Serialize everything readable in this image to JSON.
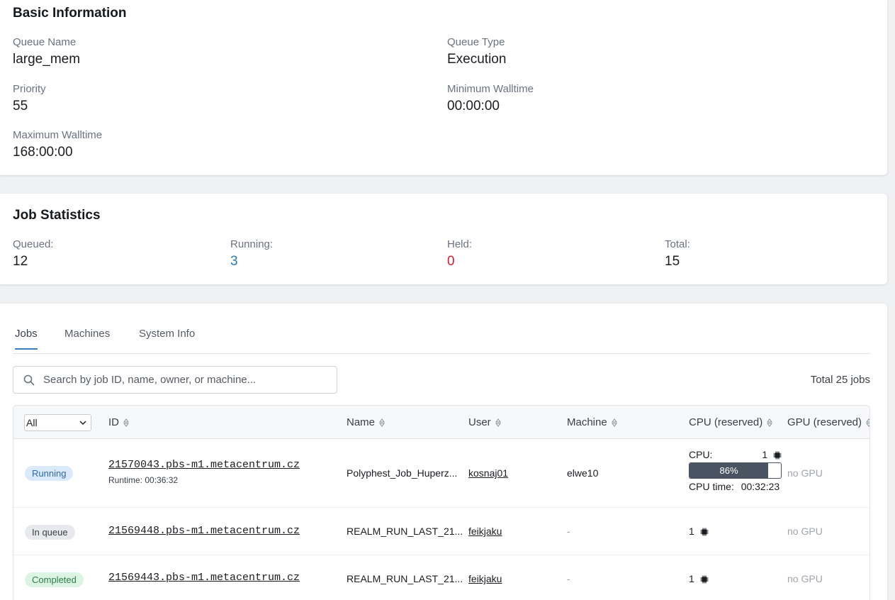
{
  "basic_info": {
    "title": "Basic Information",
    "fields": {
      "queue_name": {
        "label": "Queue Name",
        "value": "large_mem"
      },
      "queue_type": {
        "label": "Queue Type",
        "value": "Execution"
      },
      "priority": {
        "label": "Priority",
        "value": "55"
      },
      "min_walltime": {
        "label": "Minimum Walltime",
        "value": "00:00:00"
      },
      "max_walltime": {
        "label": "Maximum Walltime",
        "value": "168:00:00"
      }
    }
  },
  "job_stats": {
    "title": "Job Statistics",
    "queued": {
      "label": "Queued:",
      "value": "12"
    },
    "running": {
      "label": "Running:",
      "value": "3"
    },
    "held": {
      "label": "Held:",
      "value": "0"
    },
    "total": {
      "label": "Total:",
      "value": "15"
    },
    "colors": {
      "running": "#2a7ab8",
      "held": "#d3212d"
    }
  },
  "tabs": [
    {
      "label": "Jobs",
      "active": true
    },
    {
      "label": "Machines",
      "active": false
    },
    {
      "label": "System Info",
      "active": false
    }
  ],
  "search": {
    "placeholder": "Search by job ID, name, owner, or machine...",
    "value": ""
  },
  "total_jobs": "Total 25 jobs",
  "table": {
    "filter": {
      "selected": "All"
    },
    "headers": {
      "id": "ID",
      "name": "Name",
      "user": "User",
      "machine": "Machine",
      "cpu": "CPU (reserved)",
      "gpu": "GPU (reserved)"
    },
    "rows": [
      {
        "status": "Running",
        "id": "21570043.pbs-m1.metacentrum.cz",
        "runtime": "Runtime: 00:36:32",
        "name": "Polyphest_Job_Huperz...",
        "user": "kosnaj01",
        "machine": "elwe10",
        "cpu_label": "CPU:",
        "cpu_count": "1",
        "cpu_usage": "86%",
        "cpu_usage_fraction": 0.86,
        "cpu_time_label": "CPU time:",
        "cpu_time": "00:32:23",
        "gpu": "no GPU"
      },
      {
        "status": "In queue",
        "id": "21569448.pbs-m1.metacentrum.cz",
        "name": "REALM_RUN_LAST_21...",
        "user": "feikjaku",
        "machine": "-",
        "cpu_count": "1",
        "gpu": "no GPU"
      },
      {
        "status": "Completed",
        "id": "21569443.pbs-m1.metacentrum.cz",
        "name": "REALM_RUN_LAST_21...",
        "user": "feikjaku",
        "machine": "-",
        "cpu_count": "1",
        "gpu": "no GPU"
      }
    ]
  },
  "icons": {
    "search": "search-icon",
    "sort": "sort-icon",
    "chevron": "chevron-down-icon",
    "cpu": "cpu-chip-icon"
  }
}
